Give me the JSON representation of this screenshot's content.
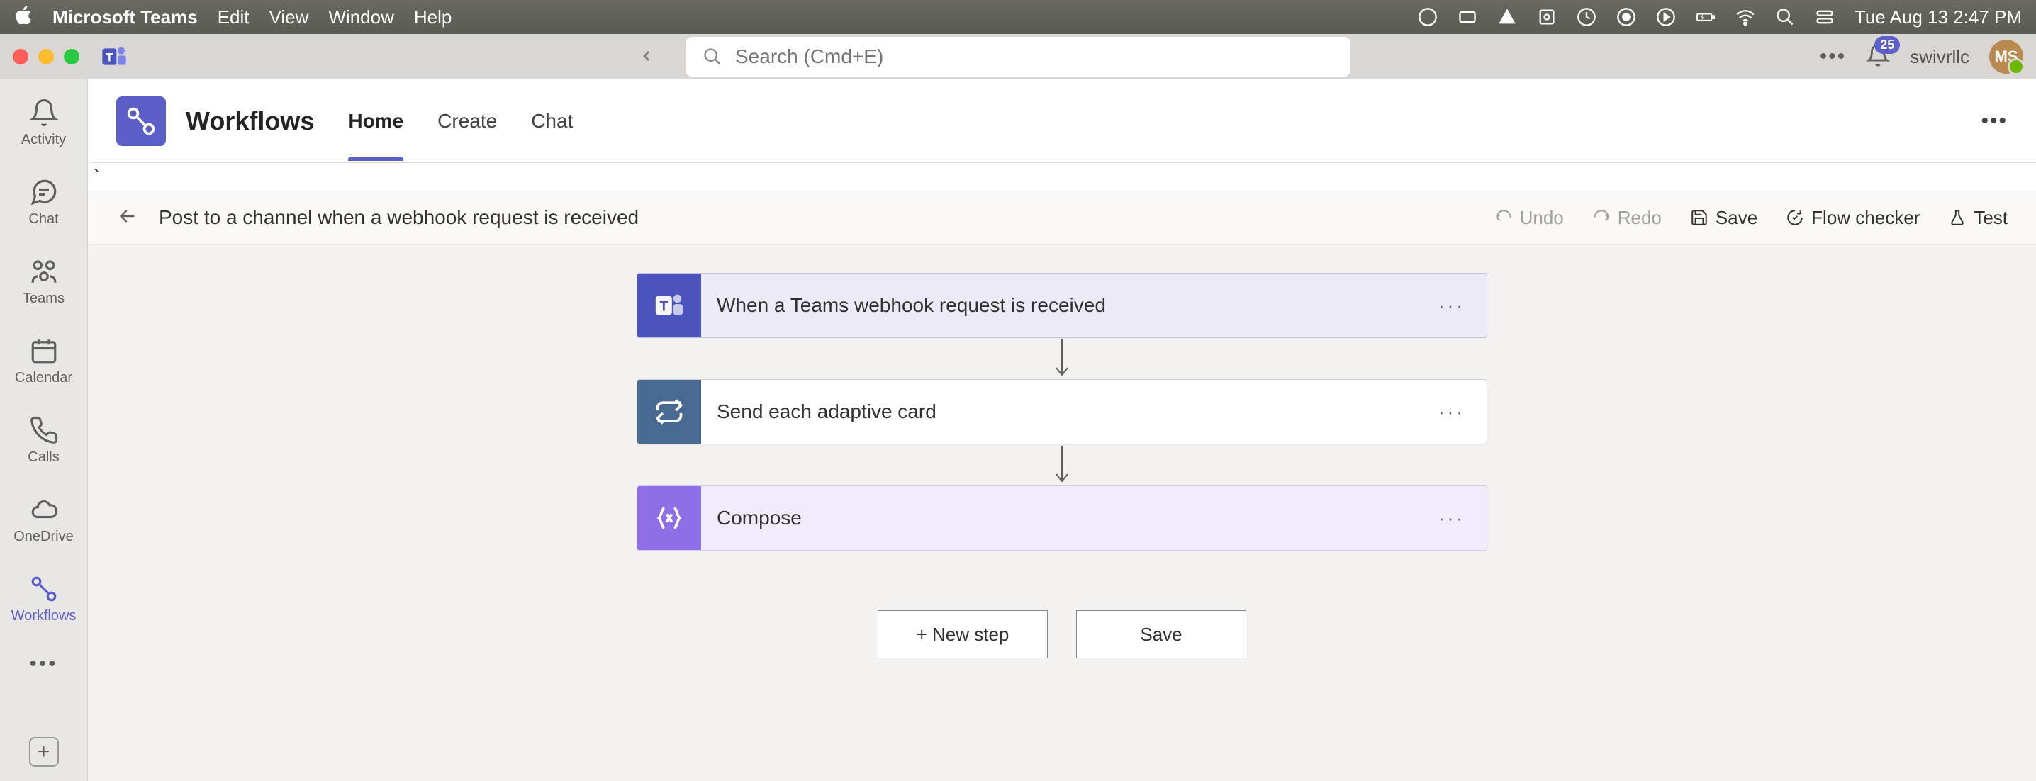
{
  "mac_menu": {
    "app_name": "Microsoft Teams",
    "items": [
      "Edit",
      "View",
      "Window",
      "Help"
    ],
    "datetime": "Tue Aug 13  2:47 PM"
  },
  "titlebar": {
    "search_placeholder": "Search (Cmd+E)",
    "notification_count": "25",
    "username": "swivrllc",
    "avatar_initials": "MS"
  },
  "rail": {
    "items": [
      {
        "label": "Activity"
      },
      {
        "label": "Chat"
      },
      {
        "label": "Teams"
      },
      {
        "label": "Calendar"
      },
      {
        "label": "Calls"
      },
      {
        "label": "OneDrive"
      },
      {
        "label": "Workflows"
      }
    ]
  },
  "app_header": {
    "title": "Workflows",
    "tabs": [
      "Home",
      "Create",
      "Chat"
    ]
  },
  "flow_bar": {
    "title": "Post to a channel when a webhook request is received",
    "undo": "Undo",
    "redo": "Redo",
    "save": "Save",
    "flow_checker": "Flow checker",
    "test": "Test"
  },
  "steps": [
    {
      "title": "When a Teams webhook request is received"
    },
    {
      "title": "Send each adaptive card"
    },
    {
      "title": "Compose"
    }
  ],
  "buttons": {
    "new_step": "+ New step",
    "save": "Save"
  },
  "stray": "`"
}
